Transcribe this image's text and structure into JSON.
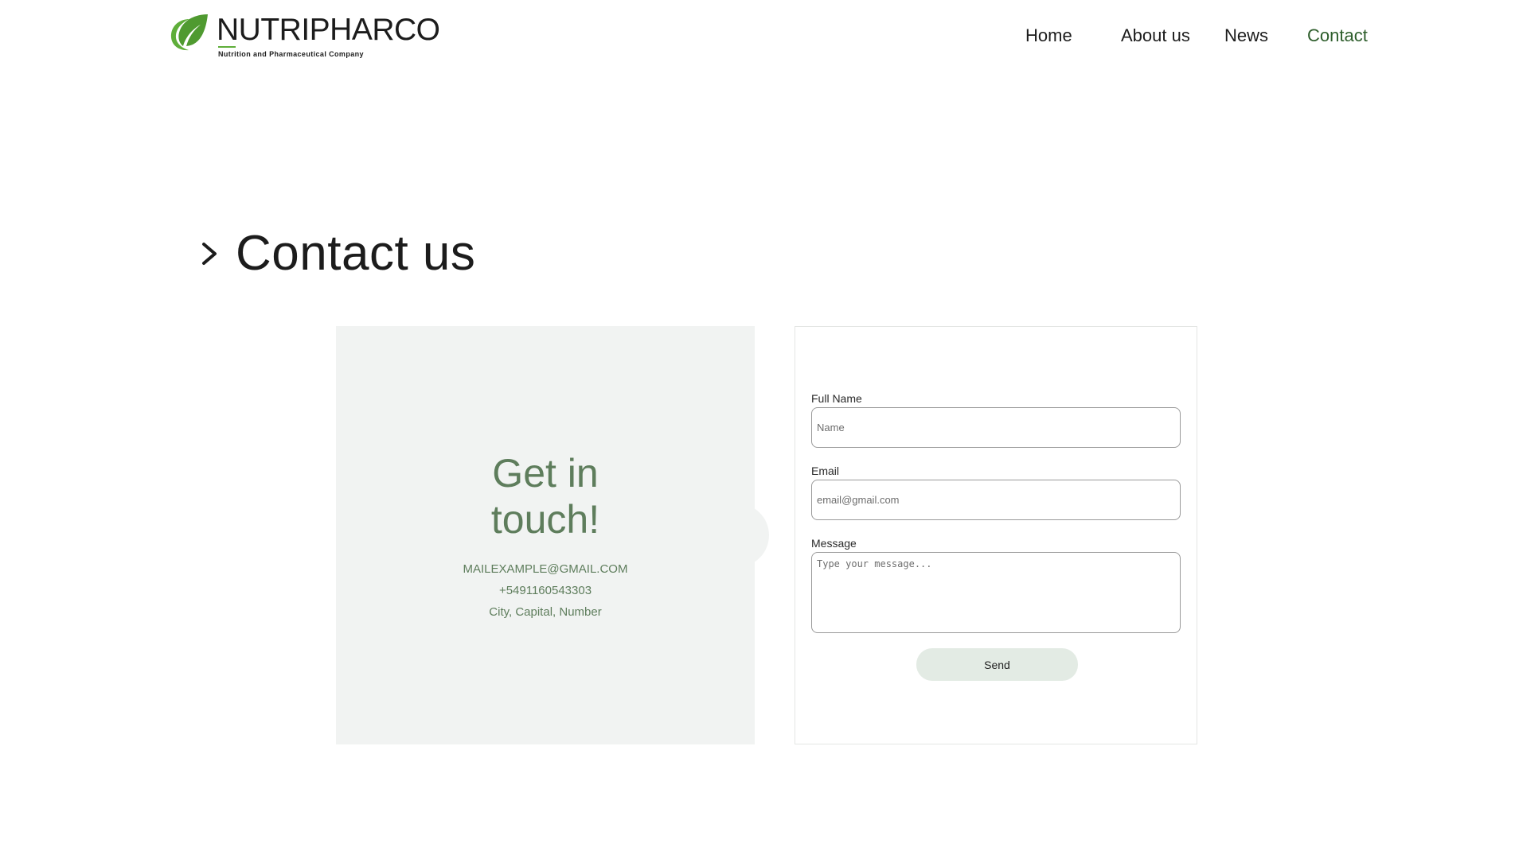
{
  "brand": {
    "name": "NUTRIPHARCO",
    "tagline": "Nutrition and Pharmaceutical Company",
    "accent": "#5fae3a"
  },
  "nav": {
    "items": [
      {
        "label": "Home"
      },
      {
        "label": "About us"
      },
      {
        "label": "News"
      },
      {
        "label": "Contact",
        "active": true
      }
    ],
    "active_color": "#2e5e2c"
  },
  "page": {
    "title": "Contact us"
  },
  "info": {
    "heading_line1": "Get in",
    "heading_line2": "touch!",
    "email": "MAILEXAMPLE@GMAIL.COM",
    "phone": "+5491160543303",
    "address": "City, Capital, Number",
    "text_color": "#5e7d5c"
  },
  "form": {
    "full_name": {
      "label": "Full Name",
      "placeholder": "Name",
      "value": ""
    },
    "email": {
      "label": "Email",
      "placeholder": "email@gmail.com",
      "value": ""
    },
    "message": {
      "label": "Message",
      "placeholder": "Type your message...",
      "value": ""
    },
    "send_label": "Send"
  }
}
